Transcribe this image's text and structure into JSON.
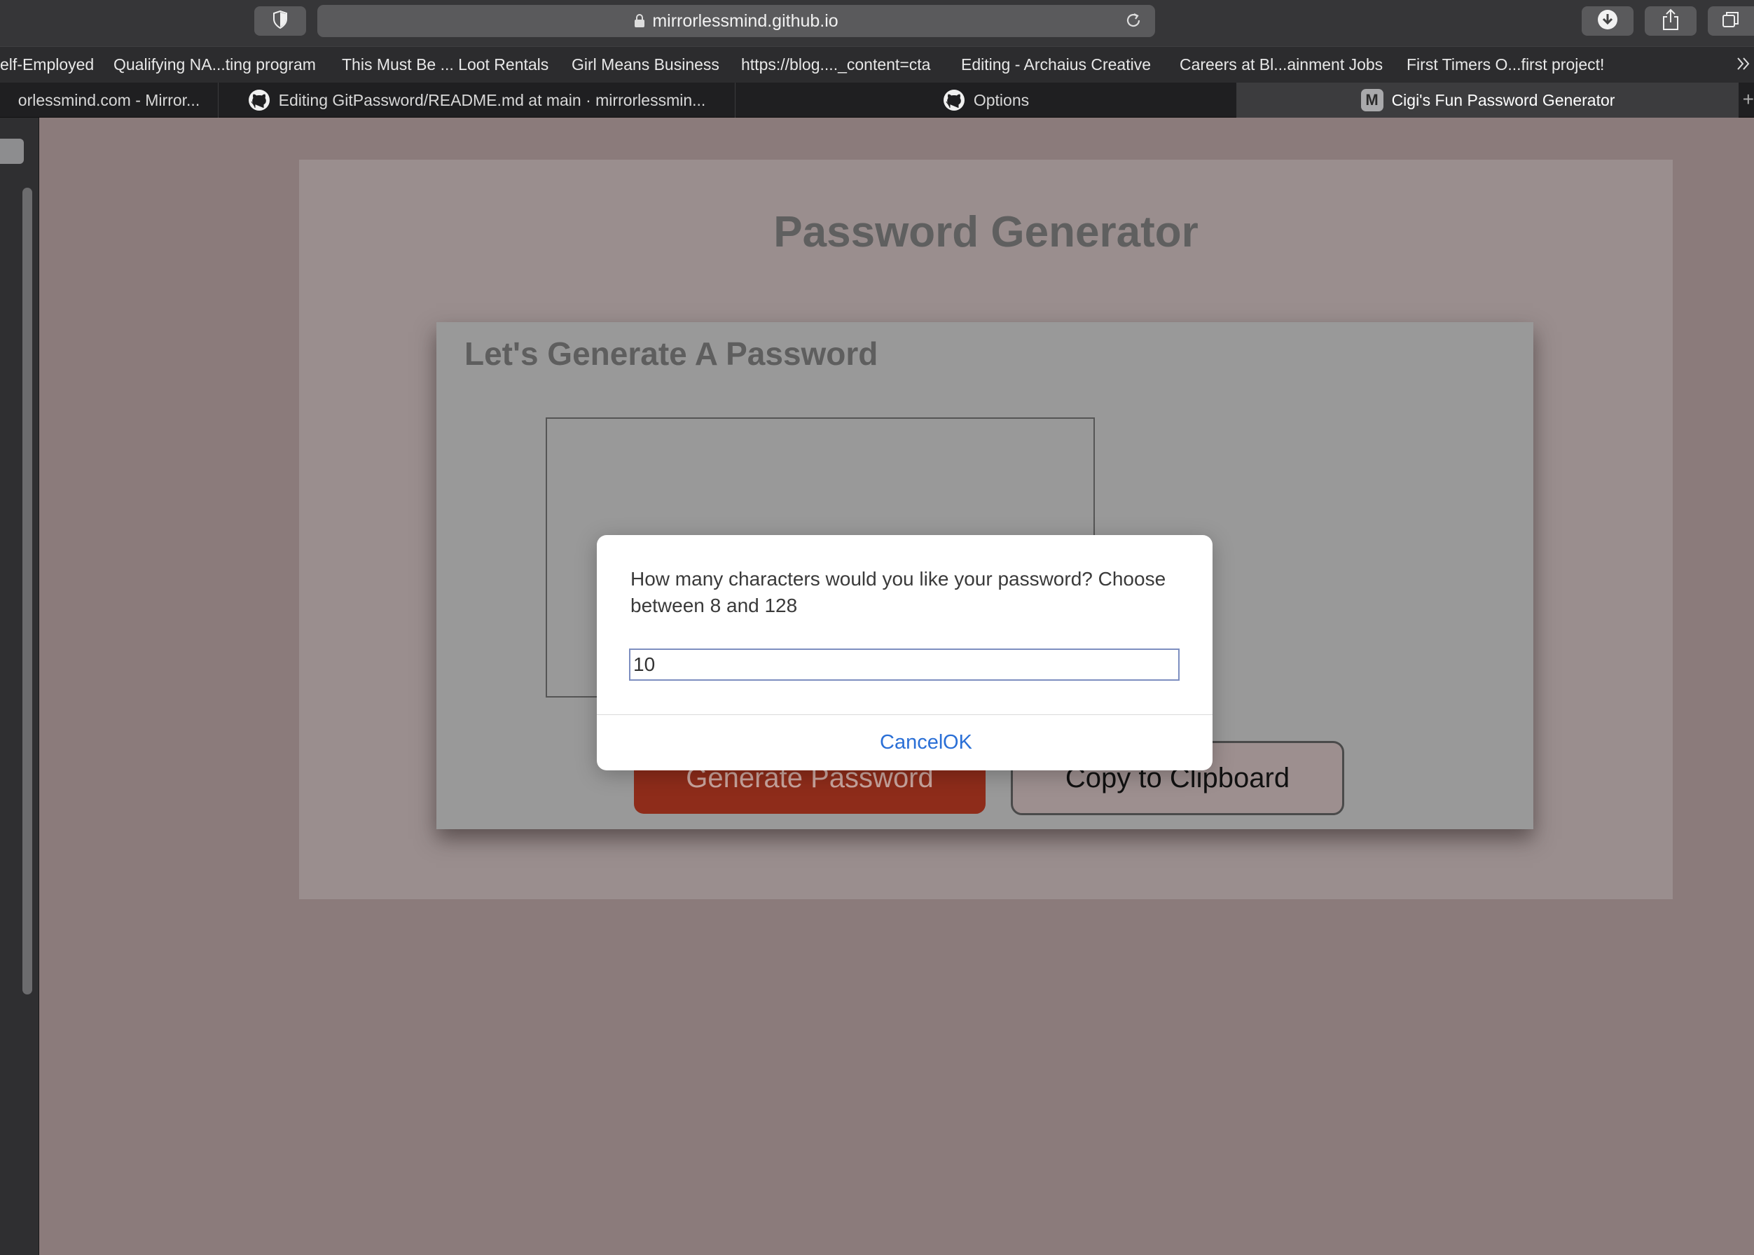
{
  "browser": {
    "url": "mirrorlessmind.github.io",
    "bookmarks": [
      "elf-Employed",
      "Qualifying NA...ting program",
      "This Must Be ... Loot Rentals",
      "Girl Means Business",
      "https://blog...._content=cta",
      "Editing - Archaius Creative",
      "Careers at Bl...ainment Jobs",
      "First Timers O...first project!"
    ],
    "tabs": [
      {
        "label": "orlessmind.com - Mirror..."
      },
      {
        "label": "Editing GitPassword/README.md at main · mirrorlessmin..."
      },
      {
        "label": "Options"
      },
      {
        "label": "Cigi's Fun Password Generator",
        "favicon_letter": "M"
      }
    ]
  },
  "page": {
    "title": "Password Generator",
    "card_header": "Let's Generate A Password",
    "generate_button": "Generate Password",
    "copy_button": "Copy to Clipboard"
  },
  "dialog": {
    "message": "How many characters would you like your password? Choose between 8 and 128",
    "input_value": "10",
    "cancel_label": "Cancel",
    "ok_label": "OK"
  },
  "colors": {
    "accent_link": "#2a6fd6",
    "generate_button": "#8e2c1a",
    "page_background": "#8b7b7b"
  },
  "icons": [
    "shield-icon",
    "lock-icon",
    "reload-icon",
    "download-icon",
    "share-icon",
    "tabs-overview-icon",
    "github-icon"
  ]
}
